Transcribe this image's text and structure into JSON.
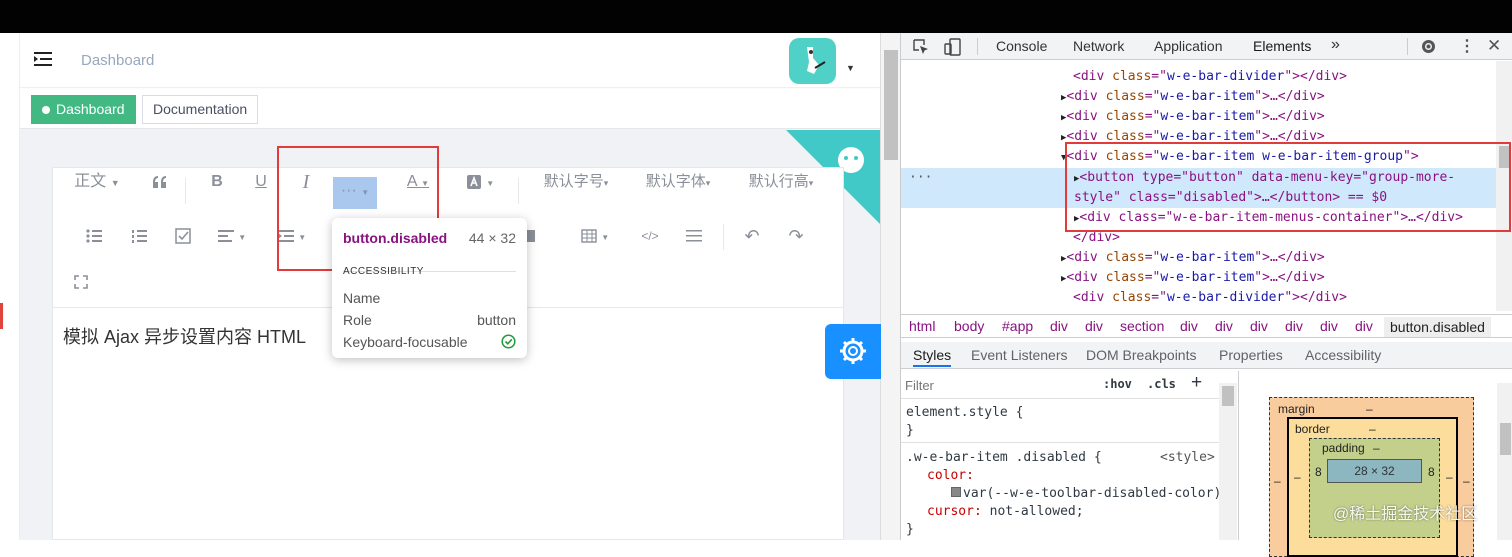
{
  "app": {
    "breadcrumb": "Dashboard",
    "tags": [
      {
        "label": "Dashboard"
      },
      {
        "label": "Documentation"
      }
    ],
    "toolbar": {
      "row1": [
        "正文",
        "默认字号",
        "默认字体",
        "默认行高"
      ],
      "more_glyph": "···"
    },
    "editor_text": "模拟 Ajax 异步设置内容 HTML"
  },
  "tooltip": {
    "selector": "button.disabled",
    "size": "44 × 32",
    "section": "ACCESSIBILITY",
    "rows": [
      {
        "k": "Name",
        "v": ""
      },
      {
        "k": "Role",
        "v": "button"
      },
      {
        "k": "Keyboard-focusable",
        "v": ""
      }
    ]
  },
  "devtools": {
    "tabs": [
      "Console",
      "Network",
      "Application",
      "Elements"
    ],
    "more_tabs": "»",
    "dom": [
      {
        "indent": 0,
        "arrow": "",
        "tag": "div",
        "cls": "w-e-bar-divider",
        "tail": "</div>"
      },
      {
        "indent": 0,
        "arrow": "▶",
        "tag": "div",
        "cls": "w-e-bar-item",
        "tail": "…</div>"
      },
      {
        "indent": 0,
        "arrow": "▶",
        "tag": "div",
        "cls": "w-e-bar-item",
        "tail": "…</div>"
      },
      {
        "indent": 0,
        "arrow": "▶",
        "tag": "div",
        "cls": "w-e-bar-item",
        "tail": "…</div>"
      },
      {
        "indent": 0,
        "arrow": "▼",
        "tag": "div",
        "cls": "w-e-bar-item w-e-bar-item-group",
        "tail": ""
      }
    ],
    "sel_line1_a": "<button type=\"button\" data-menu-key=\"group-more-",
    "sel_line1_b": "style\" class=\"disabled\">…</button> == $0",
    "menus_line": "<div class=\"w-e-bar-item-menus-container\">…</div>",
    "close_div": "</div>",
    "dom_after": [
      {
        "arrow": "▶",
        "cls": "w-e-bar-item",
        "tail": "…</div>"
      },
      {
        "arrow": "▶",
        "cls": "w-e-bar-item",
        "tail": "…</div>"
      },
      {
        "arrow": "",
        "cls": "w-e-bar-divider",
        "tail": "</div>"
      }
    ],
    "ellipsis": "···",
    "breadcrumbs": [
      "html",
      "body",
      "#app",
      "div",
      "div",
      "section",
      "div",
      "div",
      "div",
      "div",
      "div",
      "div",
      "button.disabled"
    ],
    "subtabs": [
      "Styles",
      "Event Listeners",
      "DOM Breakpoints",
      "Properties",
      "Accessibility"
    ],
    "filter_placeholder": "Filter",
    "hov": ":hov",
    "cls": ".cls",
    "plus": "+",
    "rules": {
      "element_style": "element.style {",
      "close": "}",
      "rule_selector": ".w-e-bar-item .disabled {",
      "rule_source": "<style>",
      "color_prop": "color:",
      "color_val": "var(--w-e-toolbar-disabled-color)",
      "cursor_prop": "cursor:",
      "cursor_val": "not-allowed;"
    },
    "boxmodel": {
      "margin": "margin",
      "border": "border",
      "padding": "padding",
      "dash": "–",
      "side": "8",
      "content": "28 × 32"
    }
  },
  "watermark": "@稀土掘金技术社区",
  "colors": {
    "accent": "#42b983",
    "highlight": "#e33a3a",
    "blue": "#1890ff"
  }
}
